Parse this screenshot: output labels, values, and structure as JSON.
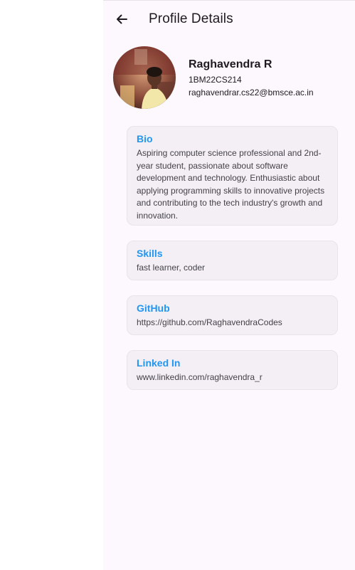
{
  "header": {
    "title": "Profile Details",
    "back_icon": "arrow-left-icon"
  },
  "profile": {
    "name": "Raghavendra R",
    "usn": "1BM22CS214",
    "email": "raghavendrar.cs22@bmsce.ac.in"
  },
  "sections": {
    "bio": {
      "title": "Bio",
      "text": "Aspiring computer science professional and 2nd-year student, passionate about software development and technology. Enthusiastic about applying programming skills to innovative projects and contributing to the tech industry's growth and innovation."
    },
    "skills": {
      "title": "Skills",
      "text": "fast learner, coder"
    },
    "github": {
      "title": "GitHub",
      "text": "https://github.com/RaghavendraCodes"
    },
    "linkedin": {
      "title": "Linked In",
      "text": "www.linkedin.com/raghavendra_r"
    }
  },
  "colors": {
    "accent": "#2196f3",
    "background": "#fdf8fd",
    "card": "#f3eff4"
  }
}
